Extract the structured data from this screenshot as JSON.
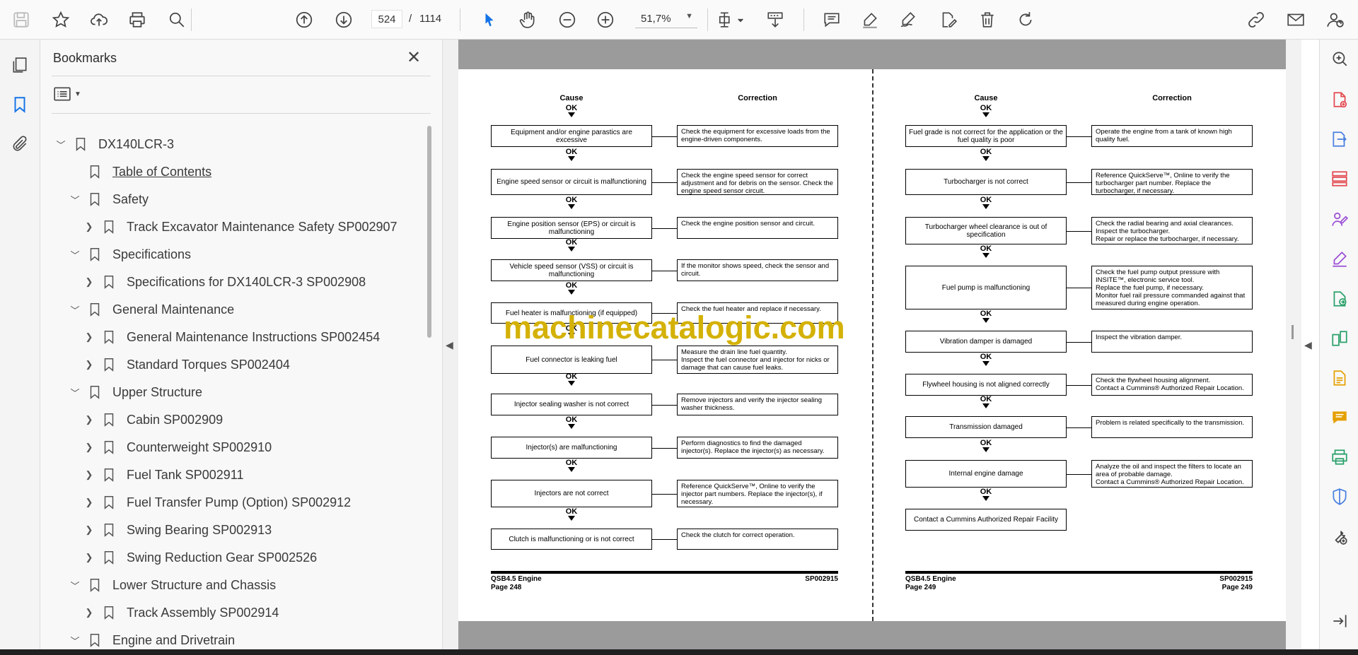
{
  "toolbar": {
    "page_number": "524",
    "page_separator": "/",
    "page_total": "1114",
    "zoom": "51,7%"
  },
  "bookmarks": {
    "title": "Bookmarks",
    "close_symbol": "✕",
    "items": [
      {
        "label": "DX140LCR-3",
        "expanded": true
      },
      {
        "label": "Table of Contents",
        "link": true
      },
      {
        "label": "Safety",
        "expanded": true
      },
      {
        "label": "Track Excavator Maintenance Safety SP002907",
        "expanded": false
      },
      {
        "label": "Specifications",
        "expanded": true
      },
      {
        "label": "Specifications for DX140LCR-3 SP002908",
        "expanded": false
      },
      {
        "label": "General Maintenance",
        "expanded": true
      },
      {
        "label": "General Maintenance Instructions SP002454",
        "expanded": false
      },
      {
        "label": "Standard Torques SP002404",
        "expanded": false
      },
      {
        "label": "Upper Structure",
        "expanded": true
      },
      {
        "label": "Cabin SP002909",
        "expanded": false
      },
      {
        "label": "Counterweight SP002910",
        "expanded": false
      },
      {
        "label": "Fuel Tank SP002911",
        "expanded": false
      },
      {
        "label": "Fuel Transfer Pump (Option) SP002912",
        "expanded": false
      },
      {
        "label": "Swing Bearing SP002913",
        "expanded": false
      },
      {
        "label": "Swing Reduction Gear SP002526",
        "expanded": false
      },
      {
        "label": "Lower Structure and Chassis",
        "expanded": true
      },
      {
        "label": "Track Assembly SP002914",
        "expanded": false
      },
      {
        "label": "Engine and Drivetrain",
        "expanded": true
      }
    ]
  },
  "document": {
    "watermark": "machinecatalogic.com",
    "left_page": {
      "cause_header": "Cause",
      "correction_header": "Correction",
      "ok_label": "OK",
      "rows": [
        {
          "cause": "Equipment and/or engine parastics are excessive",
          "correction": "Check the equipment for excessive loads from the engine-driven components."
        },
        {
          "cause": "Engine speed sensor or circuit is malfunctioning",
          "correction": "Check the engine speed sensor for correct adjustment and for debris on the sensor. Check the engine speed sensor circuit."
        },
        {
          "cause": "Engine position sensor (EPS) or circuit is malfunctioning",
          "correction": "Check the engine position sensor and circuit."
        },
        {
          "cause": "Vehicle speed sensor (VSS) or circuit is malfunctioning",
          "correction": "If the monitor shows speed, check the sensor and circuit."
        },
        {
          "cause": "Fuel heater is malfunctioning (if equipped)",
          "correction": "Check the fuel heater and replace if necessary."
        },
        {
          "cause": "Fuel connector is leaking fuel",
          "correction": "Measure the drain line fuel quantity.\nInspect the fuel connector and injector for nicks or damage that can cause fuel leaks."
        },
        {
          "cause": "Injector sealing washer is not correct",
          "correction": "Remove injectors and verify the injector sealing washer thickness."
        },
        {
          "cause": "Injector(s) are malfunctioning",
          "correction": "Perform diagnostics to find the damaged injector(s). Replace the injector(s) as necessary."
        },
        {
          "cause": "Injectors are not correct",
          "correction": "Reference QuickServe™, Online to verify the injector part numbers. Replace the injector(s), if necessary."
        },
        {
          "cause": "Clutch is malfunctioning or is not correct",
          "correction": "Check the clutch for correct operation."
        }
      ],
      "footer_left": "QSB4.5 Engine",
      "footer_page": "Page 248",
      "footer_right": "SP002915"
    },
    "right_page": {
      "cause_header": "Cause",
      "correction_header": "Correction",
      "ok_label": "OK",
      "rows": [
        {
          "cause": "Fuel grade is not correct for the application or the fuel quality is poor",
          "correction": "Operate the engine from a tank of known high quality fuel."
        },
        {
          "cause": "Turbocharger is not correct",
          "correction": "Reference QuickServe™, Online to verify the turbocharger part number. Replace the turbocharger, if necessary."
        },
        {
          "cause": "Turbocharger wheel clearance is out of specification",
          "correction": "Check the radial bearing and axial clearances.\nInspect the turbocharger.\nRepair or replace the turbocharger, if necessary."
        },
        {
          "cause": "Fuel pump is malfunctioning",
          "correction": "Check the fuel pump output pressure with INSITE™, electronic service tool.\nReplace the fuel pump, if necessary.\nMonitor fuel rail pressure commanded against that measured during engine operation."
        },
        {
          "cause": "Vibration damper is damaged",
          "correction": "Inspect the vibration damper."
        },
        {
          "cause": "Flywheel housing is not aligned correctly",
          "correction": "Check the flywheel housing alignment.\nContact a Cummins® Authorized Repair Location."
        },
        {
          "cause": "Transmission damaged",
          "correction": "Problem is related specifically to the transmission."
        },
        {
          "cause": "Internal engine damage",
          "correction": "Analyze the oil and inspect the filters to locate an area of probable damage.\nContact a Cummins® Authorized Repair Location."
        }
      ],
      "final_box": "Contact a Cummins Authorized Repair Facility",
      "footer_left": "QSB4.5 Engine",
      "footer_page": "Page 249",
      "footer_right": "SP002915"
    }
  },
  "colors": {
    "accent": "#1473e6",
    "tool_red": "#e34850",
    "tool_blue": "#4a7fe0",
    "tool_purple": "#9b4fd6",
    "tool_green": "#2aa06a",
    "tool_yellow": "#e5a000",
    "watermark": "#d4b106"
  }
}
